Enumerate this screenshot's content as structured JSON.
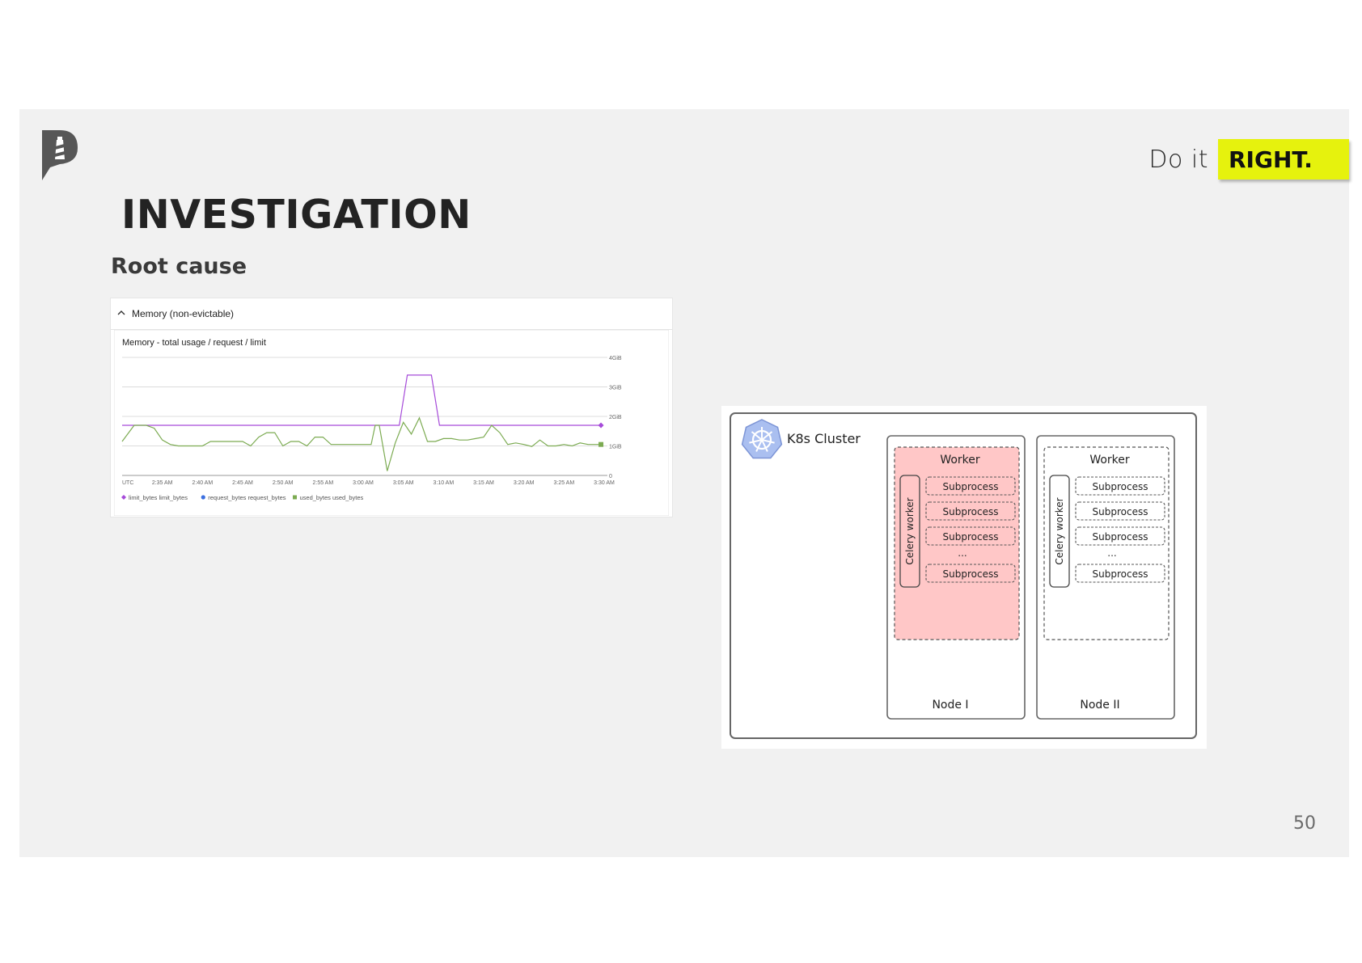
{
  "slide": {
    "tagline_prefix": "Do it",
    "tagline_highlight": "RIGHT.",
    "title": "INVESTIGATION",
    "subtitle": "Root cause",
    "page_number": "50",
    "accent_color": "#e6f20d",
    "background_color": "#f1f1f1"
  },
  "panel": {
    "section_label": "Memory (non-evictable)",
    "chart_title": "Memory - total usage / request / limit"
  },
  "chart_data": {
    "type": "line",
    "title": "Memory - total usage / request / limit",
    "x_unit_label": "UTC",
    "x_ticks": [
      "2:35 AM",
      "2:40 AM",
      "2:45 AM",
      "2:50 AM",
      "2:55 AM",
      "3:00 AM",
      "3:05 AM",
      "3:10 AM",
      "3:15 AM",
      "3:20 AM",
      "3:25 AM",
      "3:30 AM"
    ],
    "y_ticks": [
      "0",
      "1GiB",
      "2GiB",
      "3GiB",
      "4GiB"
    ],
    "ylim": [
      0,
      4
    ],
    "xlim_minutes": [
      0,
      60
    ],
    "series": [
      {
        "name": "limit_bytes limit_bytes",
        "color": "#a64bd9",
        "marker": "diamond",
        "x": [
          0,
          2,
          4,
          6,
          8,
          10,
          12,
          14,
          16,
          18,
          20,
          22,
          24,
          26,
          28,
          30,
          32,
          34,
          34.5,
          35.5,
          38.5,
          39.5,
          41,
          43,
          45,
          47,
          49,
          51,
          53,
          55,
          57,
          59.6
        ],
        "y": [
          1.7,
          1.7,
          1.7,
          1.7,
          1.7,
          1.7,
          1.7,
          1.7,
          1.7,
          1.7,
          1.7,
          1.7,
          1.7,
          1.7,
          1.7,
          1.7,
          1.7,
          1.7,
          1.7,
          3.4,
          3.4,
          1.7,
          1.7,
          1.7,
          1.7,
          1.7,
          1.7,
          1.7,
          1.7,
          1.7,
          1.7,
          1.7
        ]
      },
      {
        "name": "request_bytes request_bytes",
        "color": "#3b6fe0",
        "marker": "circle",
        "x": [],
        "y": []
      },
      {
        "name": "used_bytes used_bytes",
        "color": "#7cab52",
        "marker": "square",
        "x": [
          0,
          1.5,
          3,
          4,
          5,
          6,
          7,
          8,
          10,
          11,
          13,
          15,
          16,
          17,
          18,
          19,
          20,
          21,
          22,
          23,
          24,
          25,
          26,
          28,
          30,
          31,
          31.5,
          32,
          33,
          34,
          35,
          36,
          37,
          38,
          39,
          40,
          41,
          42,
          43,
          44,
          45,
          46,
          47,
          48,
          49,
          50,
          51,
          52,
          53,
          54,
          55,
          56,
          57,
          58,
          59,
          59.6
        ],
        "y": [
          1.15,
          1.7,
          1.7,
          1.6,
          1.2,
          1.05,
          1.0,
          1.0,
          1.0,
          1.15,
          1.15,
          1.15,
          1.0,
          1.3,
          1.45,
          1.45,
          1.0,
          1.15,
          1.15,
          1.0,
          1.3,
          1.3,
          1.05,
          1.05,
          1.05,
          1.05,
          1.7,
          1.7,
          0.15,
          1.1,
          1.8,
          1.4,
          1.95,
          1.15,
          1.15,
          1.25,
          1.25,
          1.2,
          1.2,
          1.25,
          1.3,
          1.7,
          1.45,
          1.05,
          1.1,
          1.05,
          0.98,
          1.2,
          1.0,
          1.0,
          1.05,
          1.0,
          1.1,
          1.05,
          1.05,
          1.05
        ]
      }
    ],
    "legend_placement": "bottom-left",
    "grid": true
  },
  "diagram": {
    "cluster_label": "K8s Cluster",
    "nodes": [
      {
        "worker_label": "Worker",
        "celery_label": "Celery worker",
        "subprocesses": [
          "Subprocess",
          "Subprocess",
          "Subprocess",
          "Subprocess"
        ],
        "ellipsis": "...",
        "node_label": "Node I",
        "highlight_color": "#ffc7c7"
      },
      {
        "worker_label": "Worker",
        "celery_label": "Celery worker",
        "subprocesses": [
          "Subprocess",
          "Subprocess",
          "Subprocess",
          "Subprocess"
        ],
        "ellipsis": "...",
        "node_label": "Node II",
        "highlight_color": "#ffffff"
      }
    ]
  }
}
